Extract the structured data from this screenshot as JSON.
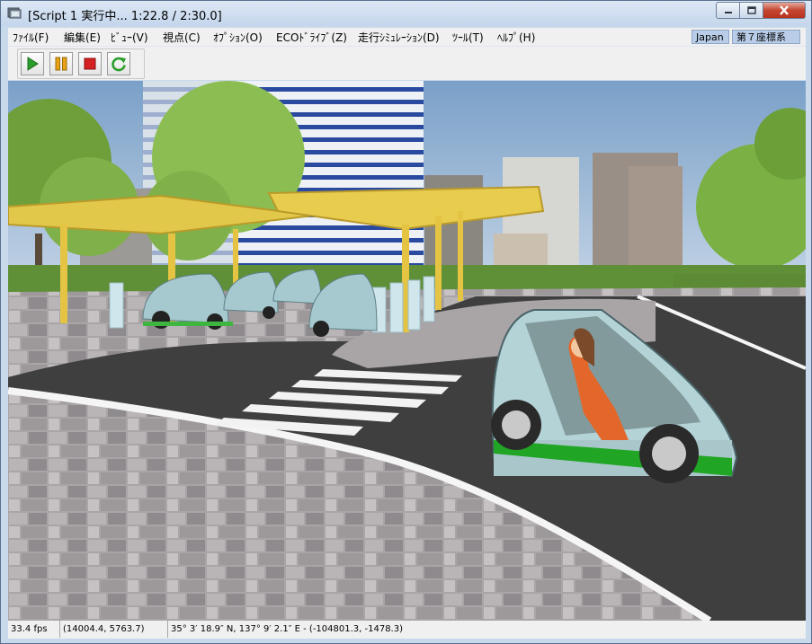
{
  "window": {
    "title": "[Script 1 実行中... 1:22.8 / 2:30.0]",
    "icon": "app-window-icon",
    "controls": [
      "minimize-icon",
      "maximize-icon",
      "close-icon"
    ]
  },
  "menubar": {
    "items": [
      {
        "label": "ﾌｧｲﾙ(F)"
      },
      {
        "label": "編集(E)"
      },
      {
        "label": "ﾋﾞｭｰ(V)"
      },
      {
        "label": "視点(C)"
      },
      {
        "label": "ｵﾌﾟｼｮﾝ(O)"
      },
      {
        "label": "ECOﾄﾞﾗｲﾌﾞ(Z)"
      },
      {
        "label": "走行ｼﾐｭﾚｰｼｮﾝ(D)"
      },
      {
        "label": "ﾂｰﾙ(T)"
      },
      {
        "label": "ﾍﾙﾌﾟ(H)"
      }
    ],
    "region": "Japan",
    "coord_system": "第７座標系"
  },
  "toolbar": {
    "buttons": [
      {
        "icon": "play-icon",
        "color": "#2a9d2a"
      },
      {
        "icon": "pause-icon",
        "color": "#e8a317"
      },
      {
        "icon": "stop-icon",
        "color": "#d42020"
      },
      {
        "icon": "loop-icon",
        "color": "#2a9d2a"
      }
    ]
  },
  "status": {
    "fps": "33.4 fps",
    "position": "(14004.4, 5763.7)",
    "geo": "35° 3′ 18.9″ N, 137° 9′ 2.1″ E - (-104801.3, -1478.3)"
  }
}
